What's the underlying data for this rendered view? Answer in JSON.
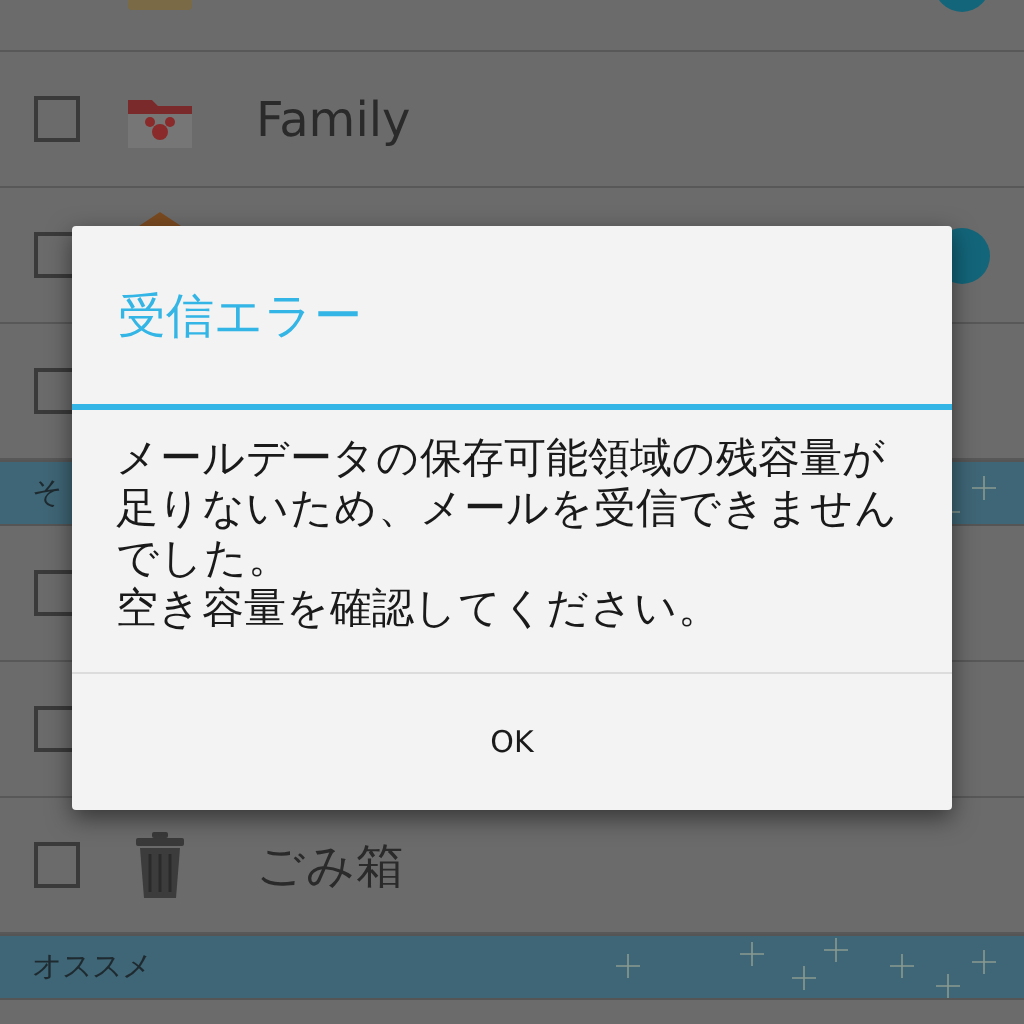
{
  "list": [
    {
      "kind": "folder",
      "badge": true
    },
    {
      "kind": "family",
      "label": "Family",
      "checked": false,
      "badge": false
    },
    {
      "kind": "bag",
      "checked": false,
      "badge": true
    },
    {
      "kind": "plain",
      "checked": false,
      "badge": false
    },
    {
      "kind": "section",
      "label": "そ"
    },
    {
      "kind": "plain",
      "checked": false,
      "badge": false
    },
    {
      "kind": "plain",
      "checked": false,
      "badge": false
    },
    {
      "kind": "trash",
      "label": "ごみ箱",
      "checked": false,
      "badge": false
    },
    {
      "kind": "section",
      "label": "オススメ"
    }
  ],
  "dialog": {
    "title": "受信エラー",
    "message": "メールデータの保存可能領域の残容量が足りないため、メールを受信できませんでした。",
    "note": "空き容量を確認してください。",
    "buttons": [
      "OK"
    ]
  }
}
